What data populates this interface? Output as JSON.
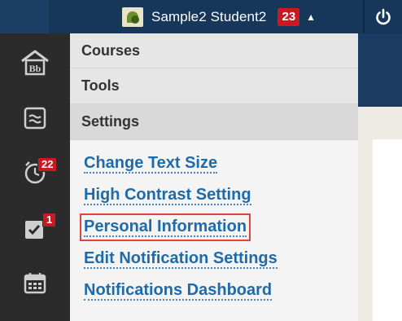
{
  "header": {
    "username": "Sample2 Student2",
    "notification_count": "23",
    "caret_icon": "caret-up-icon",
    "power_icon": "power-icon"
  },
  "sidebar": {
    "items": [
      {
        "icon": "blackboard-home-icon",
        "label": "Bb"
      },
      {
        "icon": "stream-icon"
      },
      {
        "icon": "due-dates-clock-icon",
        "badge": "22"
      },
      {
        "icon": "grades-check-icon",
        "badge": "1"
      },
      {
        "icon": "calendar-icon"
      }
    ]
  },
  "menu": {
    "sections": [
      "Courses",
      "Tools",
      "Settings"
    ],
    "active_section": "Settings",
    "links": [
      "Change Text Size",
      "High Contrast Setting",
      "Personal Information",
      "Edit Notification Settings",
      "Notifications Dashboard"
    ],
    "highlighted_link": "Personal Information"
  },
  "colors": {
    "header_bg": "#16365a",
    "sidebar_bg": "#2b2b2b",
    "badge_red": "#c81a22",
    "link_blue": "#1f6aa8",
    "highlight_outline": "#e0433a"
  }
}
